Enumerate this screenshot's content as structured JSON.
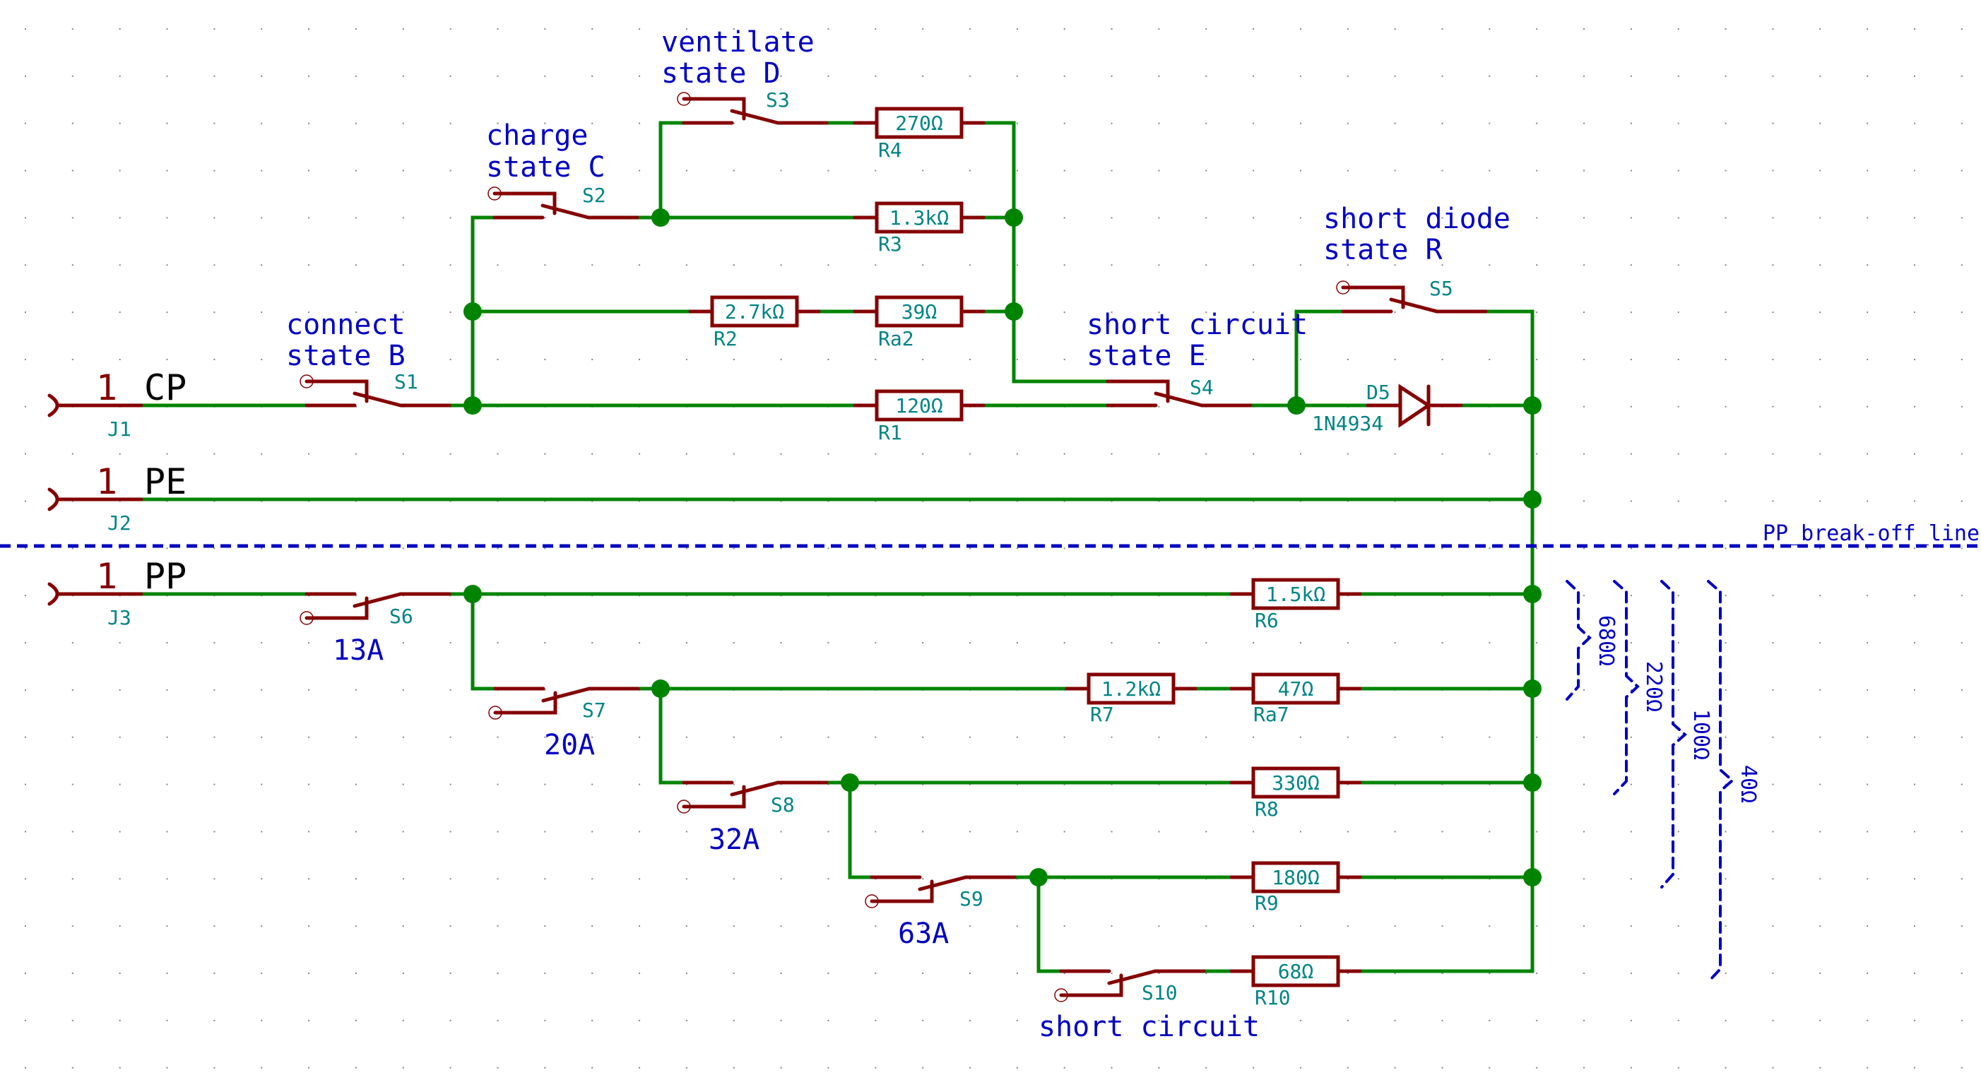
{
  "colors": {
    "wire": "#008400",
    "component": "#840000",
    "label": "#0000c2",
    "reference": "#008484",
    "net_name": "#000000",
    "grid": "#848484"
  },
  "connectors": [
    {
      "ref": "J1",
      "pin": "1",
      "net": "CP"
    },
    {
      "ref": "J2",
      "pin": "1",
      "net": "PE"
    },
    {
      "ref": "J3",
      "pin": "1",
      "net": "PP"
    }
  ],
  "switches": [
    {
      "ref": "S1",
      "label": [
        "connect",
        "state B"
      ]
    },
    {
      "ref": "S2",
      "label": [
        "charge",
        "state C"
      ]
    },
    {
      "ref": "S3",
      "label": [
        "ventilate",
        "state D"
      ]
    },
    {
      "ref": "S4",
      "label": [
        "short circuit",
        "state E"
      ]
    },
    {
      "ref": "S5",
      "label": [
        "short diode",
        "state R"
      ]
    },
    {
      "ref": "S6",
      "label": [
        "13A"
      ]
    },
    {
      "ref": "S7",
      "label": [
        "20A"
      ]
    },
    {
      "ref": "S8",
      "label": [
        "32A"
      ]
    },
    {
      "ref": "S9",
      "label": [
        "63A"
      ]
    },
    {
      "ref": "S10",
      "label": [
        "short circuit"
      ]
    }
  ],
  "resistors": [
    {
      "ref": "R4",
      "value": "270Ω"
    },
    {
      "ref": "R3",
      "value": "1.3kΩ"
    },
    {
      "ref": "R2",
      "value": "2.7kΩ"
    },
    {
      "ref": "Ra2",
      "value": "39Ω"
    },
    {
      "ref": "R1",
      "value": "120Ω"
    },
    {
      "ref": "R6",
      "value": "1.5kΩ"
    },
    {
      "ref": "R7",
      "value": "1.2kΩ"
    },
    {
      "ref": "Ra7",
      "value": "47Ω"
    },
    {
      "ref": "R8",
      "value": "330Ω"
    },
    {
      "ref": "R9",
      "value": "180Ω"
    },
    {
      "ref": "R10",
      "value": "68Ω"
    }
  ],
  "diode": {
    "ref": "D5",
    "value": "1N4934"
  },
  "break_line_label": "PP_break-off_line",
  "equivalent_resistances": [
    "680Ω",
    "220Ω",
    "100Ω",
    "40Ω"
  ]
}
